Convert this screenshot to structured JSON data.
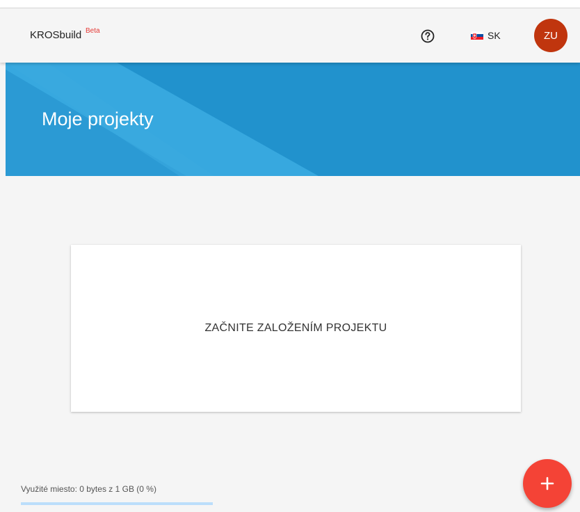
{
  "header": {
    "brand": "KROSbuild",
    "badge": "Beta",
    "help_icon": "help-circle-icon",
    "language": {
      "flag_icon": "slovakia-flag-icon",
      "code": "SK"
    },
    "user_initials": "ZU"
  },
  "banner": {
    "title": "Moje projekty"
  },
  "empty_state": {
    "message": "ZAČNITE ZALOŽENÍM PROJEKTU"
  },
  "storage": {
    "label": "Využité miesto: 0 bytes z 1 GB (0 %)",
    "used_fraction": 0
  },
  "fab": {
    "icon": "plus-icon"
  },
  "colors": {
    "banner": "#2192cd",
    "avatar": "#c0350e",
    "fab": "#f44336",
    "badge": "#e53935",
    "storage_track": "#bbdefb"
  }
}
